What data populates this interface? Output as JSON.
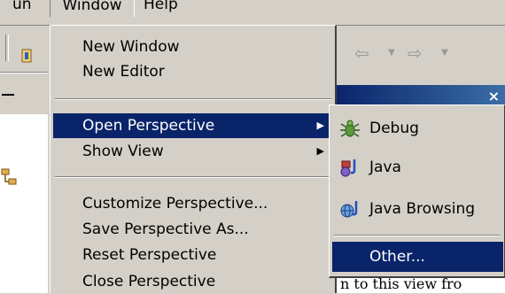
{
  "menubar": {
    "prev_label": "un",
    "window_label": "Window",
    "help_label": "Help"
  },
  "toolbar": {
    "back_glyph": "⇦",
    "forward_glyph": "⇨",
    "dropdown_glyph": "▼",
    "close_glyph": "×"
  },
  "window_menu": {
    "items": [
      {
        "label": "New Window"
      },
      {
        "label": "New Editor"
      },
      {
        "label": "Open Perspective",
        "submenu": true,
        "selected": true
      },
      {
        "label": "Show View",
        "submenu": true
      },
      {
        "label": "Customize Perspective..."
      },
      {
        "label": "Save Perspective As..."
      },
      {
        "label": "Reset Perspective"
      },
      {
        "label": "Close Perspective"
      }
    ],
    "submenu_arrow": "▶"
  },
  "perspective_submenu": {
    "items": [
      {
        "label": "Debug",
        "icon": "debug-bug-icon"
      },
      {
        "label": "Java",
        "icon": "java-perspective-icon"
      },
      {
        "label": "Java Browsing",
        "icon": "java-browsing-icon"
      },
      {
        "label": "Other...",
        "selected": true
      }
    ]
  },
  "background": {
    "view_text": "n to this view fro"
  },
  "colors": {
    "menu_bg": "#d4d0c8",
    "selection": "#0a246a",
    "selection_text": "#ffffff"
  }
}
